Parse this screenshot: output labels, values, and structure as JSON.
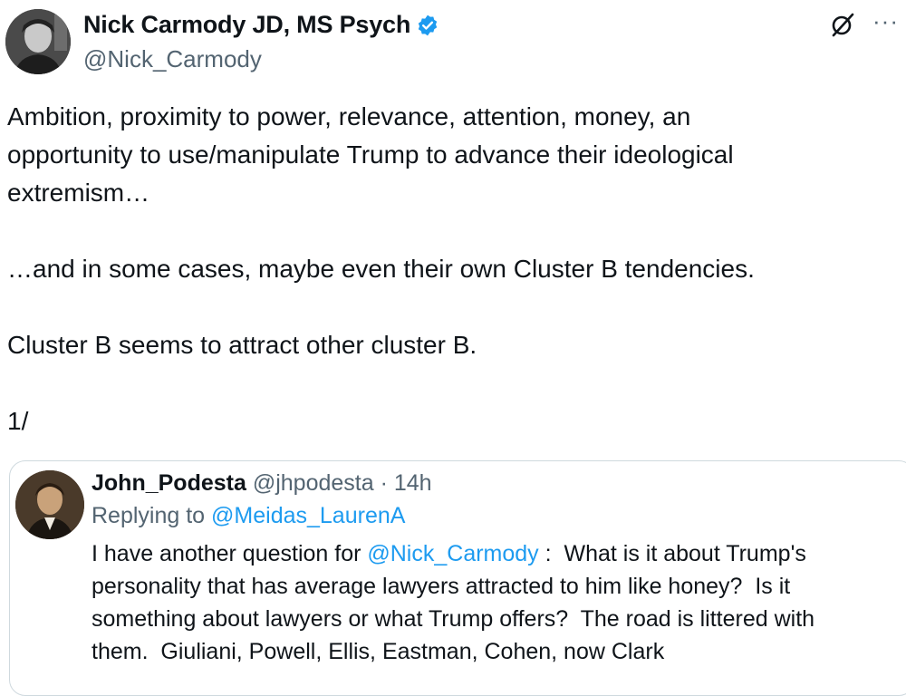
{
  "author": {
    "display_name": "Nick Carmody JD, MS Psych",
    "handle": "@Nick_Carmody",
    "avatar_icon": "profile-photo",
    "verified_icon": "verified-badge-icon",
    "verified_color": "#1d9bf0"
  },
  "actions": {
    "grok_icon": "grok-icon",
    "more_label": "···"
  },
  "tweet": {
    "text": "Ambition, proximity to power, relevance, attention, money, an\nopportunity to use/manipulate Trump to advance their ideological\nextremism…\n\n…and in some cases, maybe even their own Cluster B tendencies.\n\nCluster B seems to attract other cluster B.\n\n1/"
  },
  "quoted": {
    "display_name": "John_Podesta",
    "handle": "@jhpodesta",
    "separator": "·",
    "time": "14h",
    "replying_prefix": "Replying to",
    "replying_to": "@Meidas_LaurenA",
    "text_before_mention": "I have another question for ",
    "mention": "@Nick_Carmody",
    "text_after_mention": " :  What is it about Trump's\npersonality that has average lawyers attracted to him like honey?  Is it\nsomething about lawyers or what Trump offers?  The road is littered with\nthem.  Giuliani, Powell, Ellis, Eastman, Cohen, now Clark",
    "avatar_icon": "portrait-painting",
    "link_color": "#1d9bf0"
  }
}
